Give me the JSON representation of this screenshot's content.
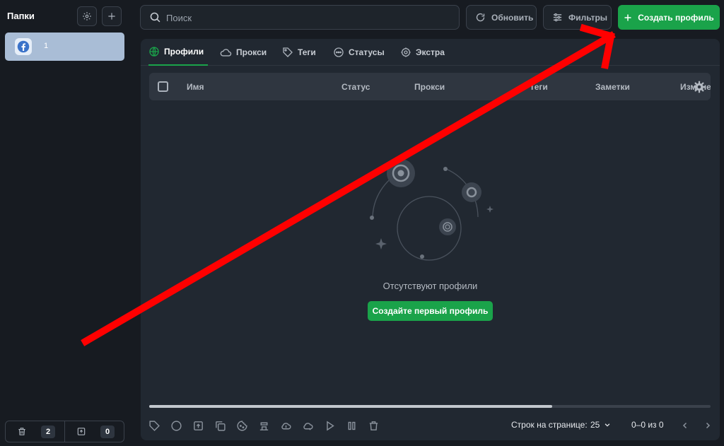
{
  "sidebar": {
    "title": "Папки",
    "folder": {
      "label": "1"
    },
    "trash_count": "2",
    "archive_count": "0"
  },
  "toolbar": {
    "search_placeholder": "Поиск",
    "refresh_label": "Обновить",
    "filters_label": "Фильтры",
    "create_label": "Создать профиль"
  },
  "tabs": [
    {
      "label": "Профили"
    },
    {
      "label": "Прокси"
    },
    {
      "label": "Теги"
    },
    {
      "label": "Статусы"
    },
    {
      "label": "Экстра"
    }
  ],
  "table": {
    "columns": [
      "Имя",
      "Статус",
      "Прокси",
      "Теги",
      "Заметки",
      "Изменено"
    ]
  },
  "empty": {
    "message": "Отсутствуют профили",
    "button": "Создайте первый профиль"
  },
  "pagination": {
    "rows_label": "Строк на странице:",
    "rows_value": "25",
    "range": "0–0 из 0"
  },
  "colors": {
    "accent": "#1aa34a",
    "annotation_arrow": "#ff0000"
  }
}
